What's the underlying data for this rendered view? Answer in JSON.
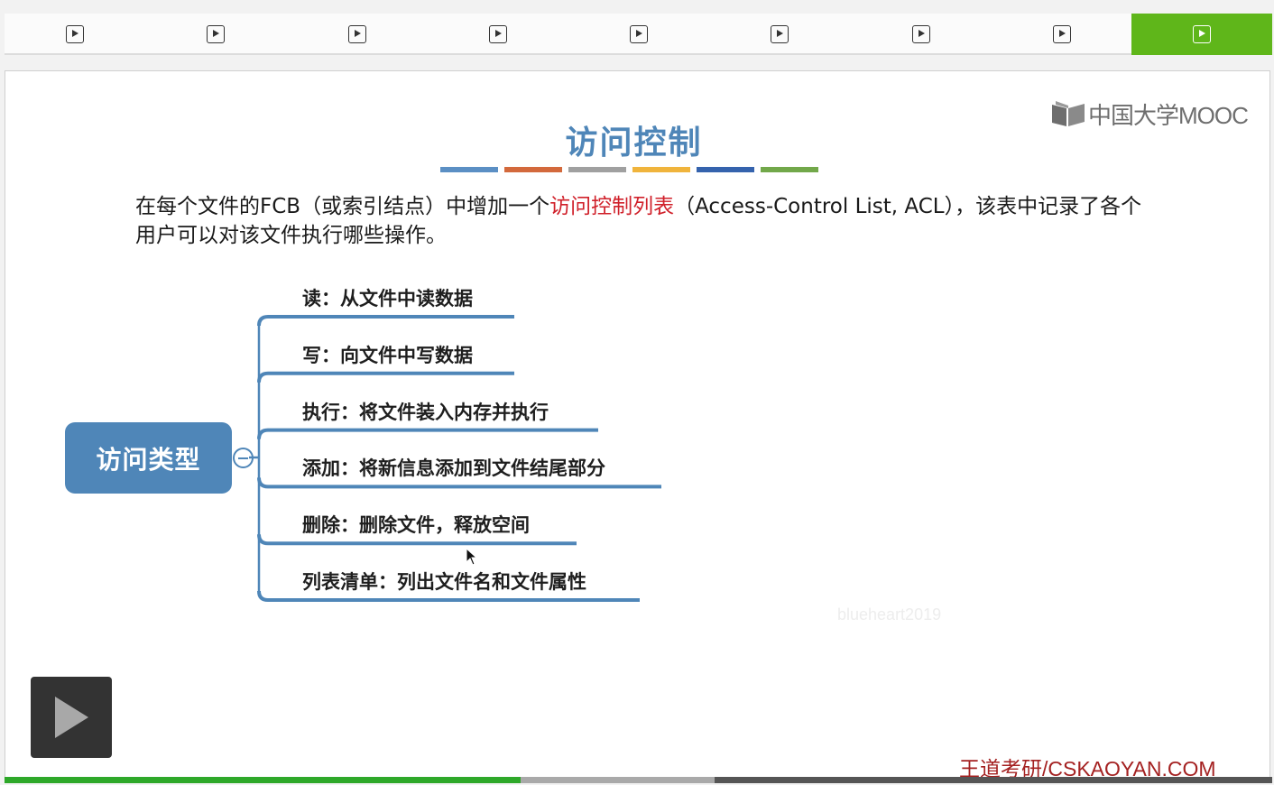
{
  "tabs": {
    "count": 9,
    "active_index": 8,
    "icon": "play-icon",
    "active_color": "#5fb61a"
  },
  "logo": {
    "icon": "mooc-book-icon",
    "text": "中国大学MOOC"
  },
  "slide": {
    "title": "访问控制",
    "title_bar_colors": [
      "#5b8fc4",
      "#d3693c",
      "#a0a0a0",
      "#f0b43c",
      "#3563ad",
      "#72a84a"
    ],
    "intro_before": "在每个文件的FCB（或索引结点）中增加一个",
    "intro_highlight": "访问控制列表",
    "intro_after": "（Access-Control List, ACL），该表中记录了各个用户可以对该文件执行哪些操作。",
    "highlight_color": "#d0202a"
  },
  "mindmap": {
    "root": "访问类型",
    "branches": [
      "读：从文件中读数据",
      "写：向文件中写数据",
      "执行：将文件装入内存并执行",
      "添加：将新信息添加到文件结尾部分",
      "删除：删除文件，释放空间",
      "列表清单：列出文件名和文件属性"
    ],
    "line_color": "#4f86b8"
  },
  "watermark": "blueheart2019",
  "brand": "王道考研/CSKAOYAN.COM",
  "progress": {
    "played_fraction": 0.407,
    "buffered_fraction": 0.56
  }
}
